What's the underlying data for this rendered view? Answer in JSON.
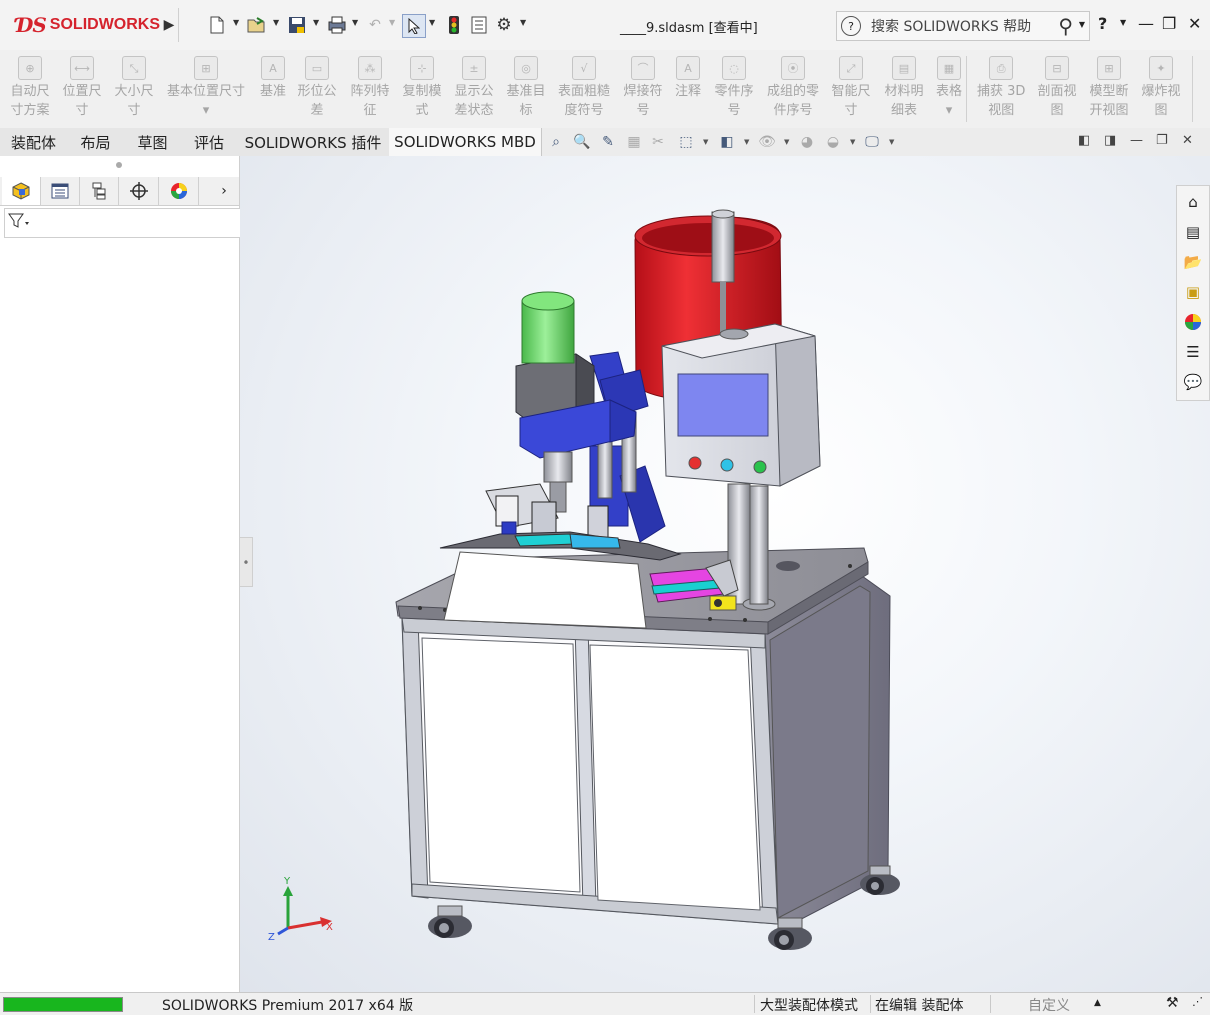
{
  "title_bar": {
    "brand": "SOLIDWORKS",
    "document_title": "____9.sldasm [查看中]",
    "help_search_placeholder": "搜索 SOLIDWORKS 帮助",
    "help_btn": "?",
    "minimize": "—",
    "restore": "❐",
    "close": "✕"
  },
  "command_manager": {
    "items": [
      {
        "label": "自动尺寸方案",
        "lines": [
          "自动尺",
          "寸方案"
        ],
        "icon": "auto-dimension-icon"
      },
      {
        "label": "位置尺寸",
        "lines": [
          "位置尺",
          "寸"
        ],
        "icon": "location-dimension-icon"
      },
      {
        "label": "大小尺寸",
        "lines": [
          "大小尺",
          "寸"
        ],
        "icon": "size-dimension-icon"
      },
      {
        "label": "基本位置尺寸",
        "lines": [
          "基本位置尺寸",
          "▾"
        ],
        "icon": "basic-location-dimension-icon"
      },
      {
        "label": "基准",
        "lines": [
          "基准"
        ],
        "icon": "datum-icon"
      },
      {
        "label": "形位公差",
        "lines": [
          "形位公",
          "差"
        ],
        "icon": "geometric-tolerance-icon"
      },
      {
        "label": "阵列特征",
        "lines": [
          "阵列特",
          "征"
        ],
        "icon": "pattern-feature-icon"
      },
      {
        "label": "复制模式",
        "lines": [
          "复制模",
          "式"
        ],
        "icon": "copy-scheme-icon"
      },
      {
        "label": "显示公差状态",
        "lines": [
          "显示公",
          "差状态"
        ],
        "icon": "show-tolerance-status-icon"
      },
      {
        "label": "基准目标",
        "lines": [
          "基准目",
          "标"
        ],
        "icon": "datum-target-icon"
      },
      {
        "label": "表面粗糙度符号",
        "lines": [
          "表面粗糙",
          "度符号"
        ],
        "icon": "surface-finish-icon"
      },
      {
        "label": "焊接符号",
        "lines": [
          "焊接符",
          "号"
        ],
        "icon": "weld-symbol-icon"
      },
      {
        "label": "注释",
        "lines": [
          "注释"
        ],
        "icon": "note-icon"
      },
      {
        "label": "零件序号",
        "lines": [
          "零件序",
          "号"
        ],
        "icon": "balloon-icon"
      },
      {
        "label": "成组的零件序号",
        "lines": [
          "成组的零",
          "件序号"
        ],
        "icon": "stacked-balloon-icon"
      },
      {
        "label": "智能尺寸",
        "lines": [
          "智能尺",
          "寸"
        ],
        "icon": "smart-dimension-icon"
      },
      {
        "label": "材料明细表",
        "lines": [
          "材料明",
          "细表"
        ],
        "icon": "bom-icon"
      },
      {
        "label": "表格",
        "lines": [
          "表格",
          "▾"
        ],
        "icon": "table-icon"
      },
      {
        "label": "捕获 3D 视图",
        "lines": [
          "捕获 3D",
          "视图"
        ],
        "icon": "capture-3d-view-icon"
      },
      {
        "label": "剖面视图",
        "lines": [
          "剖面视",
          "图"
        ],
        "icon": "section-view-icon"
      },
      {
        "label": "模型断开视图",
        "lines": [
          "模型断",
          "开视图"
        ],
        "icon": "model-break-view-icon"
      },
      {
        "label": "爆炸视图",
        "lines": [
          "爆炸视",
          "图"
        ],
        "icon": "exploded-view-icon"
      }
    ]
  },
  "tabs": [
    {
      "label": "装配体"
    },
    {
      "label": "布局"
    },
    {
      "label": "草图"
    },
    {
      "label": "评估"
    },
    {
      "label": "SOLIDWORKS 插件"
    },
    {
      "label": "SOLIDWORKS MBD",
      "active": true
    }
  ],
  "status_bar": {
    "progress": 1.0,
    "product": "SOLIDWORKS Premium 2017 x64 版",
    "mode": "大型装配体模式",
    "editing": "在编辑 装配体",
    "custom": "自定义"
  },
  "triad": {
    "x": "X",
    "y": "Y",
    "z": "Z"
  },
  "colors": {
    "brand_red": "#d5232d",
    "hopper_red": "#d9262a",
    "cylinder_green": "#6ee06a",
    "blue_body": "#3a48d8",
    "screen_blue": "#7e86f0",
    "table_gray": "#9b9ba2",
    "frame": "#c9ccd3",
    "progress_green": "#18b61e"
  }
}
